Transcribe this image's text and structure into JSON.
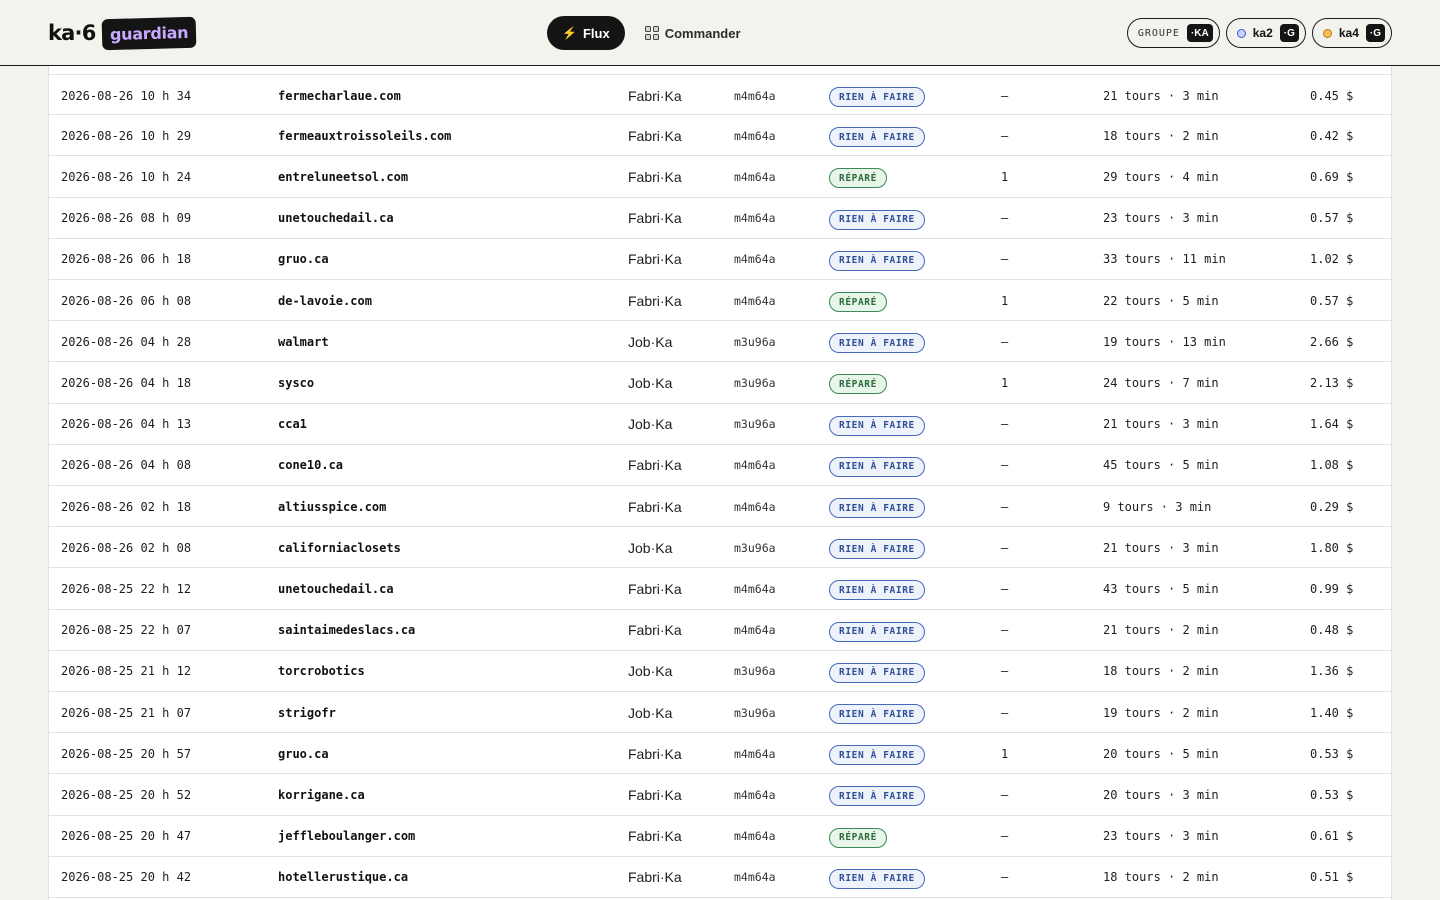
{
  "brand": {
    "name": "ka·6",
    "tag": "guardian"
  },
  "nav": [
    {
      "label": "Flux",
      "icon": "bolt-icon",
      "active": true
    },
    {
      "label": "Commander",
      "icon": "grid-icon",
      "active": false
    }
  ],
  "chips": [
    {
      "label": "GROUPE",
      "tag": "·KA",
      "dot": ""
    },
    {
      "label": "ka2",
      "tag": "·G",
      "dot": "blue"
    },
    {
      "label": "ka4",
      "tag": "·G",
      "dot": "amber"
    }
  ],
  "colors": {
    "todo": "#4669ba",
    "done": "#3b8a55",
    "accent": "#c9a9ff"
  },
  "rows": [
    {
      "date": "2026-08-26 10 h 34",
      "site": "fermecharlaue.com",
      "owner": "Fabri·Ka",
      "code": "m4m64a",
      "status": "RIEN À FAIRE",
      "kind": "todo",
      "count": "—",
      "tours": "21 tours · 3 min",
      "cost": "0.45 $"
    },
    {
      "date": "2026-08-26 10 h 29",
      "site": "fermeauxtroissoleils.com",
      "owner": "Fabri·Ka",
      "code": "m4m64a",
      "status": "RIEN À FAIRE",
      "kind": "todo",
      "count": "—",
      "tours": "18 tours · 2 min",
      "cost": "0.42 $"
    },
    {
      "date": "2026-08-26 10 h 24",
      "site": "entreluneetsol.com",
      "owner": "Fabri·Ka",
      "code": "m4m64a",
      "status": "RÉPARÉ",
      "kind": "done",
      "count": "1",
      "tours": "29 tours · 4 min",
      "cost": "0.69 $"
    },
    {
      "date": "2026-08-26 08 h 09",
      "site": "unetouchedail.ca",
      "owner": "Fabri·Ka",
      "code": "m4m64a",
      "status": "RIEN À FAIRE",
      "kind": "todo",
      "count": "—",
      "tours": "23 tours · 3 min",
      "cost": "0.57 $"
    },
    {
      "date": "2026-08-26 06 h 18",
      "site": "gruo.ca",
      "owner": "Fabri·Ka",
      "code": "m4m64a",
      "status": "RIEN À FAIRE",
      "kind": "todo",
      "count": "—",
      "tours": "33 tours · 11 min",
      "cost": "1.02 $"
    },
    {
      "date": "2026-08-26 06 h 08",
      "site": "de-lavoie.com",
      "owner": "Fabri·Ka",
      "code": "m4m64a",
      "status": "RÉPARÉ",
      "kind": "done",
      "count": "1",
      "tours": "22 tours · 5 min",
      "cost": "0.57 $"
    },
    {
      "date": "2026-08-26 04 h 28",
      "site": "walmart",
      "owner": "Job·Ka",
      "code": "m3u96a",
      "status": "RIEN À FAIRE",
      "kind": "todo",
      "count": "—",
      "tours": "19 tours · 13 min",
      "cost": "2.66 $"
    },
    {
      "date": "2026-08-26 04 h 18",
      "site": "sysco",
      "owner": "Job·Ka",
      "code": "m3u96a",
      "status": "RÉPARÉ",
      "kind": "done",
      "count": "1",
      "tours": "24 tours · 7 min",
      "cost": "2.13 $"
    },
    {
      "date": "2026-08-26 04 h 13",
      "site": "cca1",
      "owner": "Job·Ka",
      "code": "m3u96a",
      "status": "RIEN À FAIRE",
      "kind": "todo",
      "count": "—",
      "tours": "21 tours · 3 min",
      "cost": "1.64 $"
    },
    {
      "date": "2026-08-26 04 h 08",
      "site": "cone10.ca",
      "owner": "Fabri·Ka",
      "code": "m4m64a",
      "status": "RIEN À FAIRE",
      "kind": "todo",
      "count": "—",
      "tours": "45 tours · 5 min",
      "cost": "1.08 $"
    },
    {
      "date": "2026-08-26 02 h 18",
      "site": "altiusspice.com",
      "owner": "Fabri·Ka",
      "code": "m4m64a",
      "status": "RIEN À FAIRE",
      "kind": "todo",
      "count": "—",
      "tours": "9 tours · 3 min",
      "cost": "0.29 $"
    },
    {
      "date": "2026-08-26 02 h 08",
      "site": "californiaclosets",
      "owner": "Job·Ka",
      "code": "m3u96a",
      "status": "RIEN À FAIRE",
      "kind": "todo",
      "count": "—",
      "tours": "21 tours · 3 min",
      "cost": "1.80 $"
    },
    {
      "date": "2026-08-25 22 h 12",
      "site": "unetouchedail.ca",
      "owner": "Fabri·Ka",
      "code": "m4m64a",
      "status": "RIEN À FAIRE",
      "kind": "todo",
      "count": "—",
      "tours": "43 tours · 5 min",
      "cost": "0.99 $"
    },
    {
      "date": "2026-08-25 22 h 07",
      "site": "saintaimedeslacs.ca",
      "owner": "Fabri·Ka",
      "code": "m4m64a",
      "status": "RIEN À FAIRE",
      "kind": "todo",
      "count": "—",
      "tours": "21 tours · 2 min",
      "cost": "0.48 $"
    },
    {
      "date": "2026-08-25 21 h 12",
      "site": "torcrobotics",
      "owner": "Job·Ka",
      "code": "m3u96a",
      "status": "RIEN À FAIRE",
      "kind": "todo",
      "count": "—",
      "tours": "18 tours · 2 min",
      "cost": "1.36 $"
    },
    {
      "date": "2026-08-25 21 h 07",
      "site": "strigofr",
      "owner": "Job·Ka",
      "code": "m3u96a",
      "status": "RIEN À FAIRE",
      "kind": "todo",
      "count": "—",
      "tours": "19 tours · 2 min",
      "cost": "1.40 $"
    },
    {
      "date": "2026-08-25 20 h 57",
      "site": "gruo.ca",
      "owner": "Fabri·Ka",
      "code": "m4m64a",
      "status": "RIEN À FAIRE",
      "kind": "todo",
      "count": "1",
      "tours": "20 tours · 5 min",
      "cost": "0.53 $"
    },
    {
      "date": "2026-08-25 20 h 52",
      "site": "korrigane.ca",
      "owner": "Fabri·Ka",
      "code": "m4m64a",
      "status": "RIEN À FAIRE",
      "kind": "todo",
      "count": "—",
      "tours": "20 tours · 3 min",
      "cost": "0.53 $"
    },
    {
      "date": "2026-08-25 20 h 47",
      "site": "jeffleboulanger.com",
      "owner": "Fabri·Ka",
      "code": "m4m64a",
      "status": "RÉPARÉ",
      "kind": "done",
      "count": "—",
      "tours": "23 tours · 3 min",
      "cost": "0.61 $"
    },
    {
      "date": "2026-08-25 20 h 42",
      "site": "hotellerustique.ca",
      "owner": "Fabri·Ka",
      "code": "m4m64a",
      "status": "RIEN À FAIRE",
      "kind": "todo",
      "count": "—",
      "tours": "18 tours · 2 min",
      "cost": "0.51 $"
    }
  ]
}
